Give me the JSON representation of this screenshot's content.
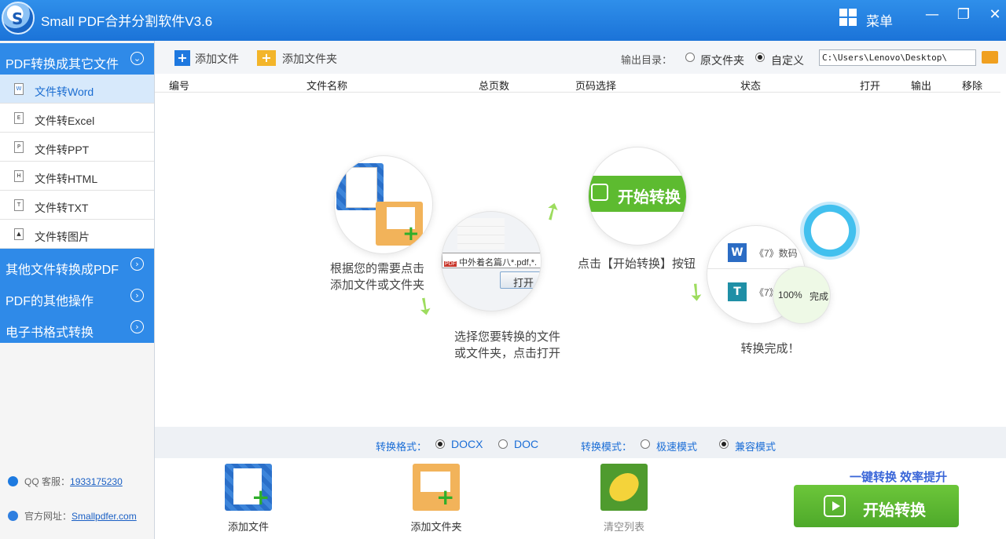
{
  "window": {
    "title": "Small PDF合并分割软件V3.6",
    "logo_letter": "S",
    "menu_label": "菜单",
    "minimize": "—",
    "maximize": "❐",
    "close": "✕"
  },
  "sidebar": {
    "categories": [
      {
        "label": "PDF转换成其它文件",
        "chevron": "⌄"
      },
      {
        "label": "其他文件转换成PDF",
        "chevron": "›"
      },
      {
        "label": "PDF的其他操作",
        "chevron": "›"
      },
      {
        "label": "电子书格式转换",
        "chevron": "›"
      }
    ],
    "items": [
      {
        "label": "文件转Word",
        "icon_letter": "W"
      },
      {
        "label": "文件转Excel",
        "icon_letter": "E"
      },
      {
        "label": "文件转PPT",
        "icon_letter": "P"
      },
      {
        "label": "文件转HTML",
        "icon_letter": "H"
      },
      {
        "label": "文件转TXT",
        "icon_letter": "T"
      },
      {
        "label": "文件转图片",
        "icon_letter": "▲"
      }
    ],
    "qq_label": "QQ 客服：",
    "qq_number": "1933175230",
    "website_label": "官方网址：",
    "website": "Smallpdfer.com"
  },
  "toolbar": {
    "add_file": "添加文件",
    "add_folder": "添加文件夹",
    "output_label": "输出目录：",
    "opt_source": "原文件夹",
    "opt_custom": "自定义",
    "path": "C:\\Users\\Lenovo\\Desktop\\"
  },
  "table": {
    "columns": [
      "编号",
      "文件名称",
      "总页数",
      "页码选择",
      "状态",
      "打开",
      "输出",
      "移除"
    ]
  },
  "guide": {
    "step1": [
      "根据您的需要点击",
      "添加文件或文件夹"
    ],
    "step2": [
      "选择您要转换的文件",
      "或文件夹，点击打开"
    ],
    "step3": "点击【开始转换】按钮",
    "step4": "转换完成！",
    "start_btn": "开始转换",
    "pdf_tag": "PDF",
    "file_name": "中外着名篇八*.pdf,*.",
    "open_btn": "打开",
    "word_item": "《7》数码",
    "txt_item": "《7》",
    "progress": "100%",
    "done": "完成"
  },
  "format_bar": {
    "format_label": "转换格式：",
    "docx": "DOCX",
    "doc": "DOC",
    "mode_label": "转换模式：",
    "fast": "极速模式",
    "compat": "兼容模式"
  },
  "bottom": {
    "add_file": "添加文件",
    "add_folder": "添加文件夹",
    "clear_list": "清空列表",
    "slogan": "一键转换  效率提升",
    "start": "开始转换"
  }
}
